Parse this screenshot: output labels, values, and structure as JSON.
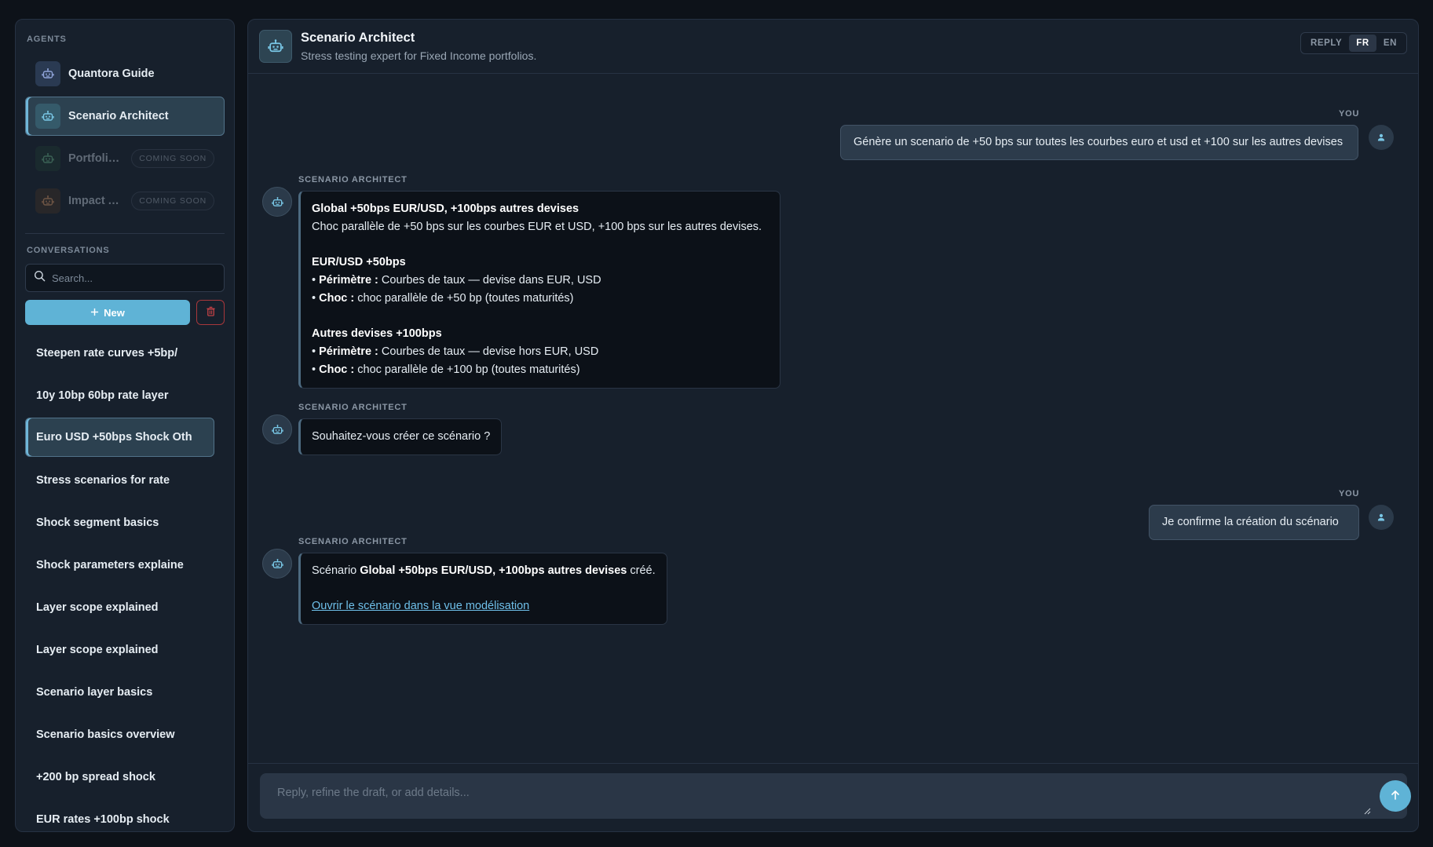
{
  "sidebar": {
    "agents_label": "AGENTS",
    "agents": [
      {
        "name": "Quantora Guide",
        "icon": "robot-icon",
        "status": "available"
      },
      {
        "name": "Scenario Architect",
        "icon": "robot-icon",
        "status": "active"
      },
      {
        "name": "Portfolio ...",
        "icon": "robot-icon",
        "status": "disabled",
        "badge": "COMING SOON"
      },
      {
        "name": "Impact A...",
        "icon": "robot-icon",
        "status": "disabled",
        "badge": "COMING SOON"
      }
    ],
    "conversations_label": "CONVERSATIONS",
    "search": {
      "placeholder": "Search...",
      "value": ""
    },
    "new_label": "New",
    "conversations": [
      {
        "title": "Steepen rate curves +5bp/"
      },
      {
        "title": "10y 10bp 60bp rate layer"
      },
      {
        "title": "Euro USD +50bps Shock Oth",
        "active": true
      },
      {
        "title": "Stress scenarios for rate"
      },
      {
        "title": "Shock segment basics"
      },
      {
        "title": "Shock parameters explaine"
      },
      {
        "title": "Layer scope explained"
      },
      {
        "title": "Layer scope explained"
      },
      {
        "title": "Scenario layer basics"
      },
      {
        "title": "Scenario basics overview"
      },
      {
        "title": "+200 bp spread shock"
      },
      {
        "title": "EUR rates +100bp shock"
      }
    ]
  },
  "header": {
    "title": "Scenario Architect",
    "subtitle": "Stress testing expert for Fixed Income portfolios.",
    "lang_options": [
      "REPLY",
      "FR",
      "EN"
    ],
    "lang_active": "FR"
  },
  "messages": [
    {
      "role": "YOU",
      "text": "Génère un scenario de +50 bps sur toutes les courbes euro et usd et +100 sur les autres devises"
    },
    {
      "role": "SCENARIO ARCHITECT",
      "title": "Global +50bps EUR/USD, +100bps autres devises",
      "summary": "Choc parallèle de +50 bps sur les courbes EUR et USD, +100 bps sur les autres devises.",
      "sections": [
        {
          "heading": "EUR/USD +50bps",
          "rows": [
            {
              "label": "Périmètre :",
              "value": "Courbes de taux — devise dans EUR, USD"
            },
            {
              "label": "Choc :",
              "value": "choc parallèle de +50 bp (toutes maturités)"
            }
          ]
        },
        {
          "heading": "Autres devises +100bps",
          "rows": [
            {
              "label": "Périmètre :",
              "value": "Courbes de taux — devise hors EUR, USD"
            },
            {
              "label": "Choc :",
              "value": "choc parallèle de +100 bp (toutes maturités)"
            }
          ]
        }
      ]
    },
    {
      "role": "SCENARIO ARCHITECT",
      "text": "Souhaitez-vous créer ce scénario ?"
    },
    {
      "role": "YOU",
      "text": "Je confirme la création du scénario"
    },
    {
      "role": "SCENARIO ARCHITECT",
      "prefix": "Scénario",
      "bold": "Global +50bps EUR/USD, +100bps autres devises",
      "suffix": "créé.",
      "link": "Ouvrir le scénario dans la vue modélisation"
    }
  ],
  "composer": {
    "placeholder": "Reply, refine the draft, or add details...",
    "value": ""
  },
  "colors": {
    "accent": "#5fb3d6",
    "background": "#0d1219",
    "panel": "#17202c",
    "danger": "#a8373b",
    "link": "#6fc0ea"
  }
}
